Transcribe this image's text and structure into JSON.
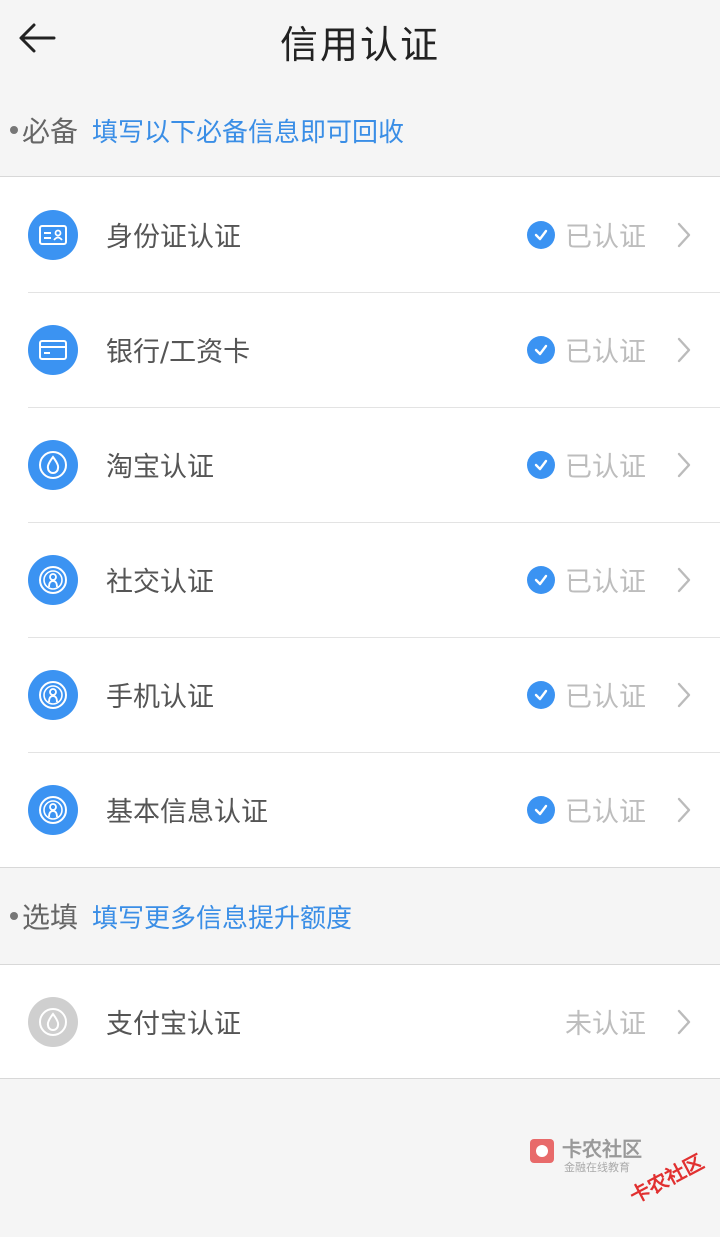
{
  "header": {
    "title": "信用认证",
    "back_icon": "arrow-left-icon"
  },
  "required_section": {
    "label": "必备",
    "hint": "填写以下必备信息即可回收",
    "items": [
      {
        "label": "身份证认证",
        "status": "已认证",
        "icon": "id-card-icon",
        "verified": true
      },
      {
        "label": "银行/工资卡",
        "status": "已认证",
        "icon": "bank-card-icon",
        "verified": true
      },
      {
        "label": "淘宝认证",
        "status": "已认证",
        "icon": "taobao-drop-icon",
        "verified": true
      },
      {
        "label": "社交认证",
        "status": "已认证",
        "icon": "user-circle-icon",
        "verified": true
      },
      {
        "label": "手机认证",
        "status": "已认证",
        "icon": "user-circle-icon",
        "verified": true
      },
      {
        "label": "基本信息认证",
        "status": "已认证",
        "icon": "user-circle-icon",
        "verified": true
      }
    ]
  },
  "optional_section": {
    "label": "选填",
    "hint": "填写更多信息提升额度",
    "items": [
      {
        "label": "支付宝认证",
        "status": "未认证",
        "icon": "alipay-drop-icon",
        "verified": false
      }
    ]
  },
  "watermark": {
    "brand": "卡农社区",
    "sub": "金融在线教育",
    "stamp": "卡农社区"
  },
  "colors": {
    "accent": "#3b93f2",
    "hint_text": "#3a8ee6",
    "inactive_icon": "#cfcfcf",
    "status_text": "#bdbdbd"
  }
}
